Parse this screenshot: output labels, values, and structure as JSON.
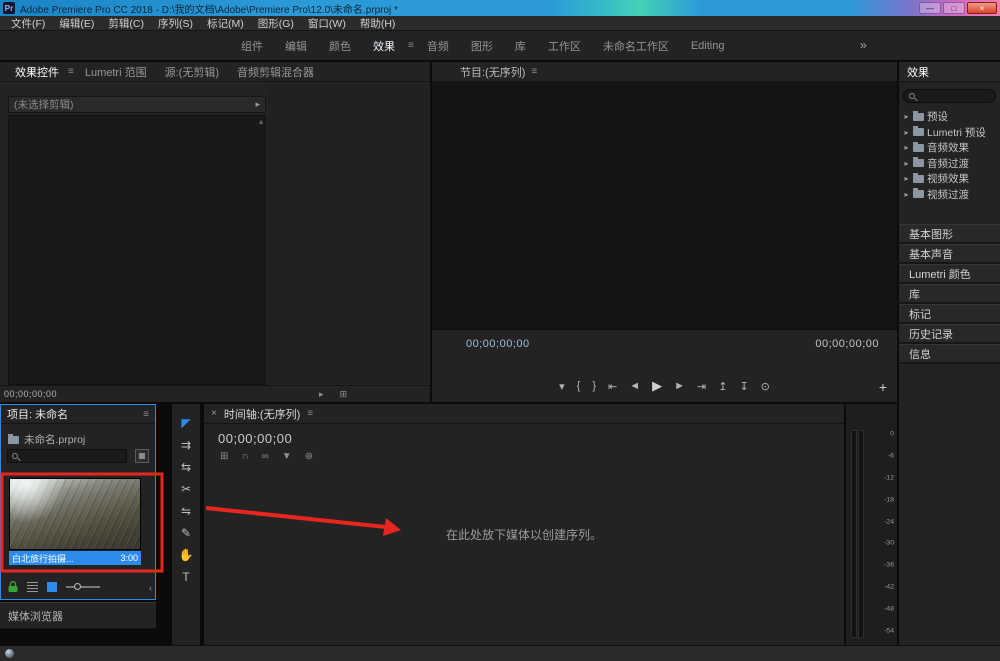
{
  "colors": {
    "accent": "#2d8ceb",
    "annotation_red": "#e8251f"
  },
  "icons": {
    "panel_menu": "≡",
    "overflow": "»",
    "close": "×",
    "disclosure": "▸",
    "scroll_up": "▴",
    "scroll_left": "‹"
  },
  "title_bar": {
    "app_icon_label": "Pr",
    "title": "Adobe Premiere Pro CC 2018 - D:\\我的文档\\Adobe\\Premiere Pro\\12.0\\未命名.prproj *",
    "minimize_glyph": "—",
    "maximize_glyph": "□",
    "close_glyph": "×"
  },
  "menu_bar": {
    "items": [
      "文件(F)",
      "编辑(E)",
      "剪辑(C)",
      "序列(S)",
      "标记(M)",
      "图形(G)",
      "窗口(W)",
      "帮助(H)"
    ]
  },
  "workspace_bar": {
    "tabs": [
      "组件",
      "编辑",
      "颜色",
      "效果",
      "音频",
      "图形",
      "库",
      "工作区",
      "未命名工作区",
      "Editing"
    ]
  },
  "effect_controls_panel": {
    "tabs": [
      "效果控件",
      "Lumetri 范围",
      "源:(无剪辑)",
      "音频剪辑混合器"
    ],
    "no_clip_label": "(未选择剪辑)",
    "timecode": "00;00;00;00",
    "bottom_icons": [
      "▸",
      "⊞"
    ]
  },
  "program_panel": {
    "title": "节目:(无序列)",
    "timecode_current": "00;00;00;00",
    "timecode_duration": "00;00;00;00",
    "transport_glyphs": [
      "▾",
      "{",
      "}",
      "⇤",
      "◄",
      "▶",
      "►",
      "⇥",
      "↥",
      "↧",
      "⊙"
    ],
    "add_button_glyph": "+"
  },
  "effects_panel": {
    "tab": "效果",
    "tree": [
      {
        "label": "预设"
      },
      {
        "label": "Lumetri 预设"
      },
      {
        "label": "音频效果"
      },
      {
        "label": "音频过渡"
      },
      {
        "label": "视频效果"
      },
      {
        "label": "视频过渡"
      }
    ],
    "stacked_tabs": [
      "基本图形",
      "基本声音",
      "Lumetri 颜色",
      "库",
      "标记",
      "历史记录",
      "信息"
    ]
  },
  "project_panel": {
    "title": "项目: 未命名",
    "file_name": "未命名.prproj",
    "clip_name": "白北旅行拍摄...",
    "clip_duration": "3:00",
    "media_browser_tab": "媒体浏览器"
  },
  "tools": [
    {
      "name": "selection",
      "glyph": "◤"
    },
    {
      "name": "track-select-forward",
      "glyph": "⇉"
    },
    {
      "name": "ripple-edit",
      "glyph": "⇆"
    },
    {
      "name": "razor",
      "glyph": "✂"
    },
    {
      "name": "slip",
      "glyph": "⇋"
    },
    {
      "name": "pen",
      "glyph": "✎"
    },
    {
      "name": "hand",
      "glyph": "✋"
    },
    {
      "name": "type",
      "glyph": "T"
    }
  ],
  "timeline_panel": {
    "title": "时间轴:(无序列)",
    "timecode": "00;00;00;00",
    "toolbar_glyphs": [
      "⊞",
      "∩",
      "∞",
      "▼",
      "⊛"
    ],
    "drop_message": "在此处放下媒体以创建序列。"
  },
  "audio_meter": {
    "labels": [
      "0",
      "-6",
      "-12",
      "-18",
      "-24",
      "-30",
      "-36",
      "-42",
      "-48",
      "-54"
    ]
  }
}
